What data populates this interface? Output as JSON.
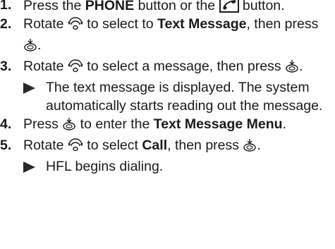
{
  "steps": [
    {
      "number": "1.",
      "t1": "Press the ",
      "b1": "PHONE",
      "t2": " button or the ",
      "t3": " button.",
      "icons": [
        "phone-pickup-icon"
      ]
    },
    {
      "number": "2.",
      "t1": "Rotate ",
      "t2": " to select to ",
      "b1": "Text Message",
      "t3": ", then press ",
      "t4": ".",
      "icons": [
        "rotate-knob-icon",
        "press-knob-icon"
      ]
    },
    {
      "number": "3.",
      "t1": "Rotate ",
      "t2": " to select a message, then press ",
      "t3": ".",
      "result": "The text message is displayed. The system automatically starts reading out the message.",
      "icons": [
        "rotate-knob-icon",
        "press-knob-icon"
      ]
    },
    {
      "number": "4.",
      "t1": "Press ",
      "t2": " to enter the ",
      "b1": "Text Message Menu",
      "t3": ".",
      "icons": [
        "press-knob-icon"
      ]
    },
    {
      "number": "5.",
      "t1": "Rotate ",
      "t2": " to select ",
      "b1": "Call",
      "t3": ", then press ",
      "t4": ".",
      "result": "HFL begins dialing.",
      "icons": [
        "rotate-knob-icon",
        "press-knob-icon"
      ]
    }
  ]
}
